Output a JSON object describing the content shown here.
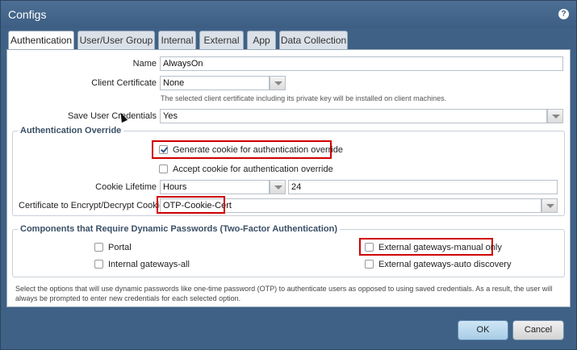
{
  "window": {
    "title": "Configs",
    "help_icon": "?"
  },
  "tabs": [
    {
      "label": "Authentication",
      "active": true
    },
    {
      "label": "User/User Group"
    },
    {
      "label": "Internal"
    },
    {
      "label": "External"
    },
    {
      "label": "App"
    },
    {
      "label": "Data Collection"
    }
  ],
  "form": {
    "name_label": "Name",
    "name_value": "AlwaysOn",
    "client_cert_label": "Client Certificate",
    "client_cert_value": "None",
    "client_cert_hint": "The selected client certificate including its private key will be installed on client machines.",
    "save_creds_label": "Save User Credentials",
    "save_creds_value": "Yes"
  },
  "auth_override": {
    "title": "Authentication Override",
    "generate_cookie_label": "Generate cookie for authentication override",
    "generate_cookie_checked": true,
    "accept_cookie_label": "Accept cookie for authentication override",
    "accept_cookie_checked": false,
    "cookie_lifetime_label": "Cookie Lifetime",
    "cookie_lifetime_unit": "Hours",
    "cookie_lifetime_value": "24",
    "cert_label": "Certificate to Encrypt/Decrypt Cookie",
    "cert_value": "OTP-Cookie-Cert"
  },
  "dynamic_pw": {
    "title": "Components that Require Dynamic Passwords (Two-Factor Authentication)",
    "portal": "Portal",
    "internal_gw": "Internal gateways-all",
    "external_manual": "External gateways-manual only",
    "external_auto": "External gateways-auto discovery",
    "note": "Select the options that will use dynamic passwords like one-time password (OTP) to authenticate users as opposed to using saved credentials. As a result, the user will always be prompted to enter new credentials for each selected option."
  },
  "buttons": {
    "ok": "OK",
    "cancel": "Cancel"
  },
  "colors": {
    "title_bar": "#3f6186",
    "highlight": "#d00000",
    "ok_button": "#a9cde6"
  }
}
